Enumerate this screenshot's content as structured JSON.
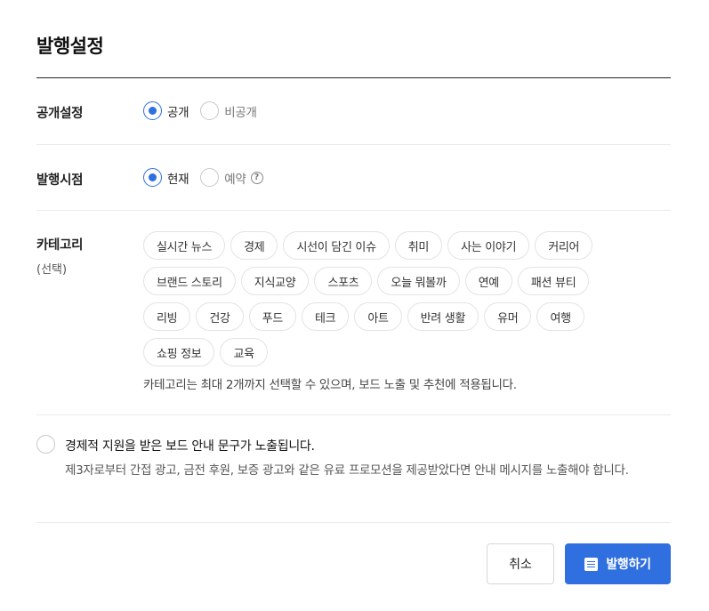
{
  "dialog": {
    "title": "발행설정"
  },
  "visibility": {
    "label": "공개설정",
    "options": [
      {
        "label": "공개",
        "checked": true
      },
      {
        "label": "비공개",
        "checked": false
      }
    ]
  },
  "publish_time": {
    "label": "발행시점",
    "options": [
      {
        "label": "현재",
        "checked": true
      },
      {
        "label": "예약",
        "checked": false
      }
    ],
    "help_icon": "?"
  },
  "category": {
    "label": "카테고리",
    "sublabel": "(선택)",
    "rows": [
      [
        "실시간 뉴스",
        "경제",
        "시선이 담긴 이슈",
        "취미",
        "사는 이야기",
        "커리어"
      ],
      [
        "브랜드 스토리",
        "지식교양",
        "스포츠",
        "오늘 뭐볼까",
        "연예",
        "패션 뷰티"
      ],
      [
        "리빙",
        "건강",
        "푸드",
        "테크",
        "아트",
        "반려 생활",
        "유머",
        "여행"
      ],
      [
        "쇼핑 정보",
        "교육"
      ]
    ],
    "hint": "카테고리는 최대 2개까지 선택할 수 있으며, 보드 노출 및 추천에 적용됩니다."
  },
  "sponsorship": {
    "title": "경제적 지원을 받은 보드 안내 문구가 노출됩니다.",
    "description": "제3자로부터 간접 광고, 금전 후원, 보증 광고와 같은 유료 프로모션을 제공받았다면 안내 메시지를 노출해야 합니다.",
    "checked": false
  },
  "buttons": {
    "cancel": "취소",
    "publish": "발행하기"
  },
  "colors": {
    "accent": "#2f6fdf",
    "divider": "#eaeaea",
    "chip_border": "#e3e3e3"
  }
}
